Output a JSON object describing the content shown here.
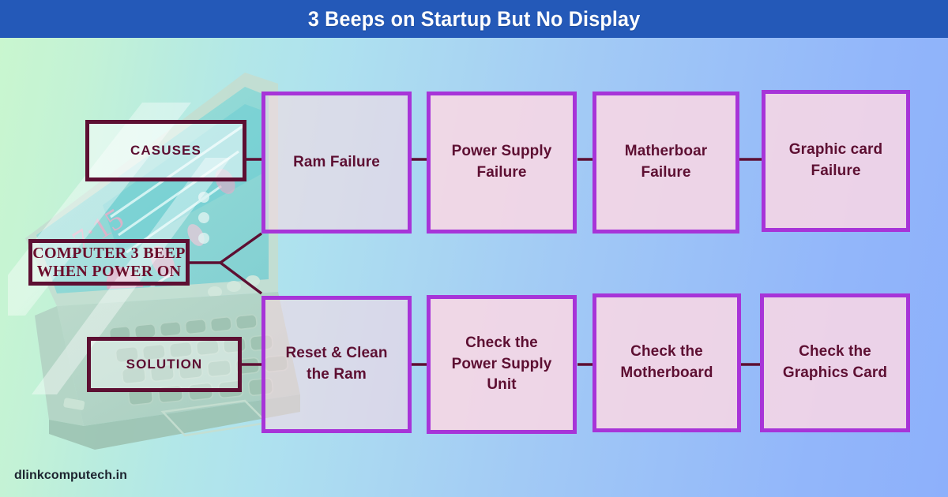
{
  "header": {
    "title": "3 Beeps on Startup But No Display",
    "bar_color": "#2459b8",
    "text_color": "#ffffff"
  },
  "theme": {
    "box_border_color": "#a734d8",
    "box_fill_color": "#fdd8e4",
    "label_border_color": "#5d0f32",
    "text_color": "#5d0f32",
    "background_gradient_start": "#c9f6cf",
    "background_gradient_end": "#8db0fb"
  },
  "root": {
    "line1": "COMPUTER 3 BEEP",
    "line2": "WHEN POWER ON"
  },
  "rows": [
    {
      "label": "CASUSES",
      "label_name": "causes",
      "items": [
        {
          "text": "Ram Failure",
          "translucent": true
        },
        {
          "text": "Power Supply\nFailure",
          "translucent": false
        },
        {
          "text": "Matherboar\nFailure",
          "translucent": false
        },
        {
          "text": "Graphic card\nFailure",
          "translucent": false
        }
      ]
    },
    {
      "label": "SOLUTION",
      "label_name": "solution",
      "items": [
        {
          "text": "Reset & Clean\nthe Ram",
          "translucent": true
        },
        {
          "text": "Check the\nPower Supply\nUnit",
          "translucent": false
        },
        {
          "text": "Check the\nMotherboard",
          "translucent": false
        },
        {
          "text": "Check the\nGraphics Card",
          "translucent": false
        }
      ]
    }
  ],
  "causes_boxes": {
    "b0": "Ram Failure",
    "b1": "Power Supply\nFailure",
    "b2": "Matherboar\nFailure",
    "b3": "Graphic card\nFailure"
  },
  "solution_boxes": {
    "b0": "Reset & Clean\nthe Ram",
    "b1": "Check the\nPower Supply\nUnit",
    "b2": "Check the\nMotherboard",
    "b3": "Check the\nGraphics Card"
  },
  "labels": {
    "causes": "CASUSES",
    "solution": "SOLUTION"
  },
  "footer": {
    "watermark": "dlinkcomputech.in"
  },
  "illustration": {
    "name": "isometric-laptop",
    "screen_clock_text": "7:15"
  }
}
